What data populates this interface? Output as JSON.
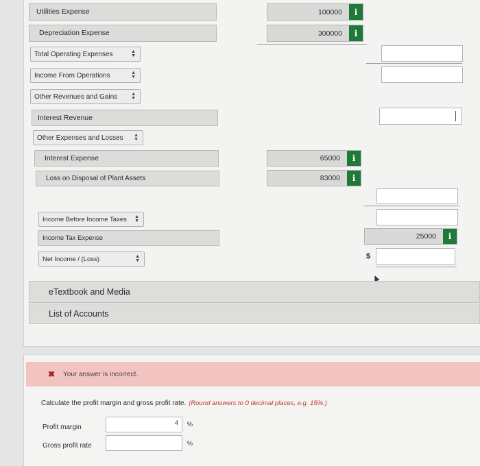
{
  "rows": {
    "utilities_expense": "Utilities Expense",
    "utilities_value": "100000",
    "depreciation_expense": "Depreciation Expense",
    "depreciation_value": "300000",
    "total_operating_expenses": "Total Operating Expenses",
    "income_from_operations": "Income From Operations",
    "other_revenues_and_gains": "Other Revenues and Gains",
    "interest_revenue": "Interest Revenue",
    "other_expenses_and_losses": "Other Expenses and Losses",
    "interest_expense": "Interest Expense",
    "interest_expense_value": "65000",
    "loss_on_disposal": "Loss on Disposal of Plant Assets",
    "loss_on_disposal_value": "83000",
    "income_before_taxes": "Income Before Income Taxes",
    "income_tax_expense": "Income Tax Expense",
    "income_tax_value": "25000",
    "net_income": "Net Income / (Loss)",
    "currency_symbol": "$"
  },
  "info_label": "i",
  "links": {
    "etextbook": "eTextbook and Media",
    "list_of_accounts": "List of Accounts"
  },
  "feedback": {
    "incorrect": "Your answer is incorrect."
  },
  "question": {
    "prompt": "Calculate the profit margin and gross profit rate.",
    "instruction": "(Round answers to 0 decimal places, e.g. 15%.)",
    "profit_margin_label": "Profit margin",
    "profit_margin_value": "4",
    "gross_profit_rate_label": "Gross profit rate",
    "gross_profit_rate_value": "",
    "percent": "%"
  }
}
